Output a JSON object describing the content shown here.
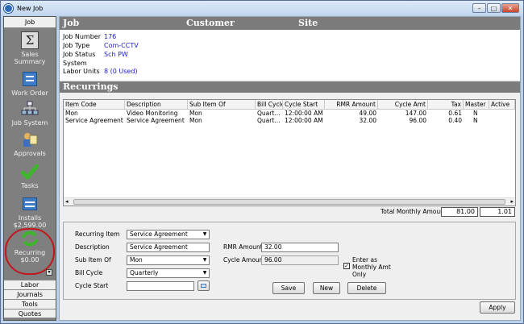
{
  "window": {
    "title": "New Job"
  },
  "sidebar": {
    "header": "Job",
    "items": [
      {
        "label": "Sales Summary",
        "icon": "sigma-icon"
      },
      {
        "label": "Work Order",
        "icon": "form-icon"
      },
      {
        "label": "Job System",
        "icon": "network-icon"
      },
      {
        "label": "Approvals",
        "icon": "approval-icon"
      },
      {
        "label": "Tasks",
        "icon": "checkmark-icon"
      },
      {
        "label": "Installs",
        "sub": "$2,599.00",
        "icon": "list-icon"
      },
      {
        "label": "Recurring",
        "sub": "$0.00",
        "icon": "recycle-icon"
      }
    ],
    "bottom": [
      "Labor",
      "Journals",
      "Tools",
      "Quotes"
    ]
  },
  "header": {
    "job": "Job",
    "customer": "Customer",
    "site": "Site"
  },
  "job_info": {
    "rows": [
      {
        "label": "Job Number",
        "value": "176"
      },
      {
        "label": "Job Type",
        "value": "Com-CCTV"
      },
      {
        "label": "Job Status",
        "value": "Sch PW"
      },
      {
        "label": "System",
        "value": ""
      },
      {
        "label": "Labor Units",
        "value": "8 (0 Used)"
      }
    ]
  },
  "recurrings": {
    "title": "Recurrings",
    "columns": [
      "Item Code",
      "Description",
      "Sub Item Of",
      "Bill Cycle",
      "Cycle Start",
      "RMR Amount",
      "Cycle Amt",
      "Tax",
      "Master",
      "Active"
    ],
    "rows": [
      [
        "Mon",
        "Video Monitoring",
        "Mon",
        "Quart…",
        "12:00:00 AM",
        "49.00",
        "147.00",
        "0.61",
        "N",
        ""
      ],
      [
        "Service Agreement",
        "Service Agreement",
        "Mon",
        "Quart…",
        "12:00:00 AM",
        "32.00",
        "96.00",
        "0.40",
        "N",
        ""
      ]
    ],
    "total_label": "Total Monthly Amount",
    "total_values": [
      "81.00",
      "1.01"
    ]
  },
  "form": {
    "recurring_item_label": "Recurring Item",
    "recurring_item_value": "Service Agreement",
    "description_label": "Description",
    "description_value": "Service Agreement",
    "sub_item_label": "Sub Item Of",
    "sub_item_value": "Mon",
    "bill_cycle_label": "Bill Cycle",
    "bill_cycle_value": "Quarterly",
    "cycle_start_label": "Cycle Start",
    "cycle_start_value": "",
    "rmr_label": "RMR Amount",
    "rmr_value": "32.00",
    "cycle_amount_label": "Cycle Amount",
    "cycle_amount_value": "96.00",
    "monthly_check_label": "Enter as Monthly Amt Only",
    "monthly_checked": true,
    "save": "Save",
    "new": "New",
    "delete": "Delete"
  },
  "apply": "Apply"
}
